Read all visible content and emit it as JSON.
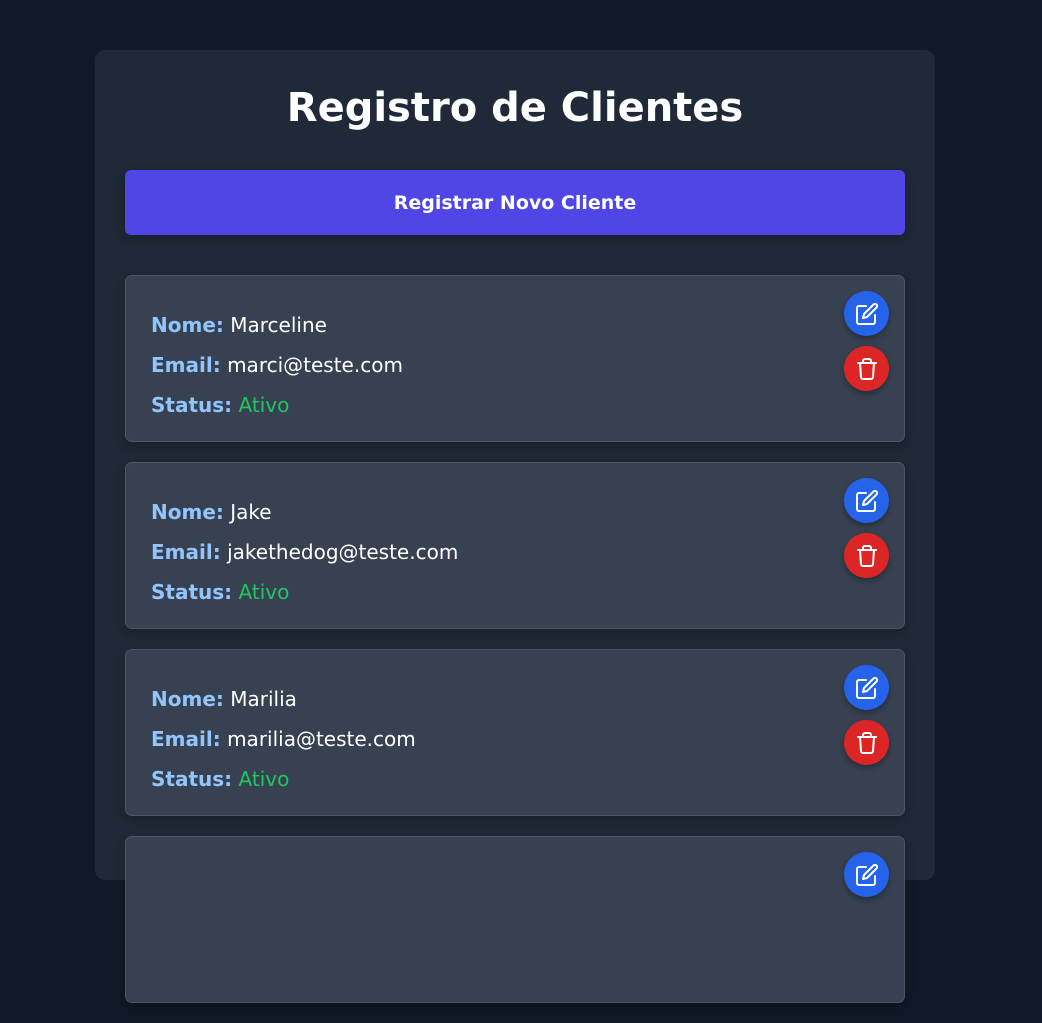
{
  "page": {
    "title": "Registro de Clientes",
    "register_button_label": "Registrar Novo Cliente"
  },
  "labels": {
    "name": "Nome:",
    "email": "Email:",
    "status": "Status:"
  },
  "clients": [
    {
      "name": "Marceline",
      "email": "marci@teste.com",
      "status": "Ativo"
    },
    {
      "name": "Jake",
      "email": "jakethedog@teste.com",
      "status": "Ativo"
    },
    {
      "name": "Marilia",
      "email": "marilia@teste.com",
      "status": "Ativo"
    },
    {
      "name": "",
      "email": "",
      "status": ""
    }
  ],
  "colors": {
    "background": "#111827",
    "panel": "#1f2937",
    "card": "#374151",
    "primary_button": "#4f46e5",
    "label": "#93c5fd",
    "status_active": "#22c55e",
    "edit_button": "#2563eb",
    "delete_button": "#dc2626"
  },
  "icons": {
    "edit": "pencil-square-icon",
    "delete": "trash-icon"
  }
}
